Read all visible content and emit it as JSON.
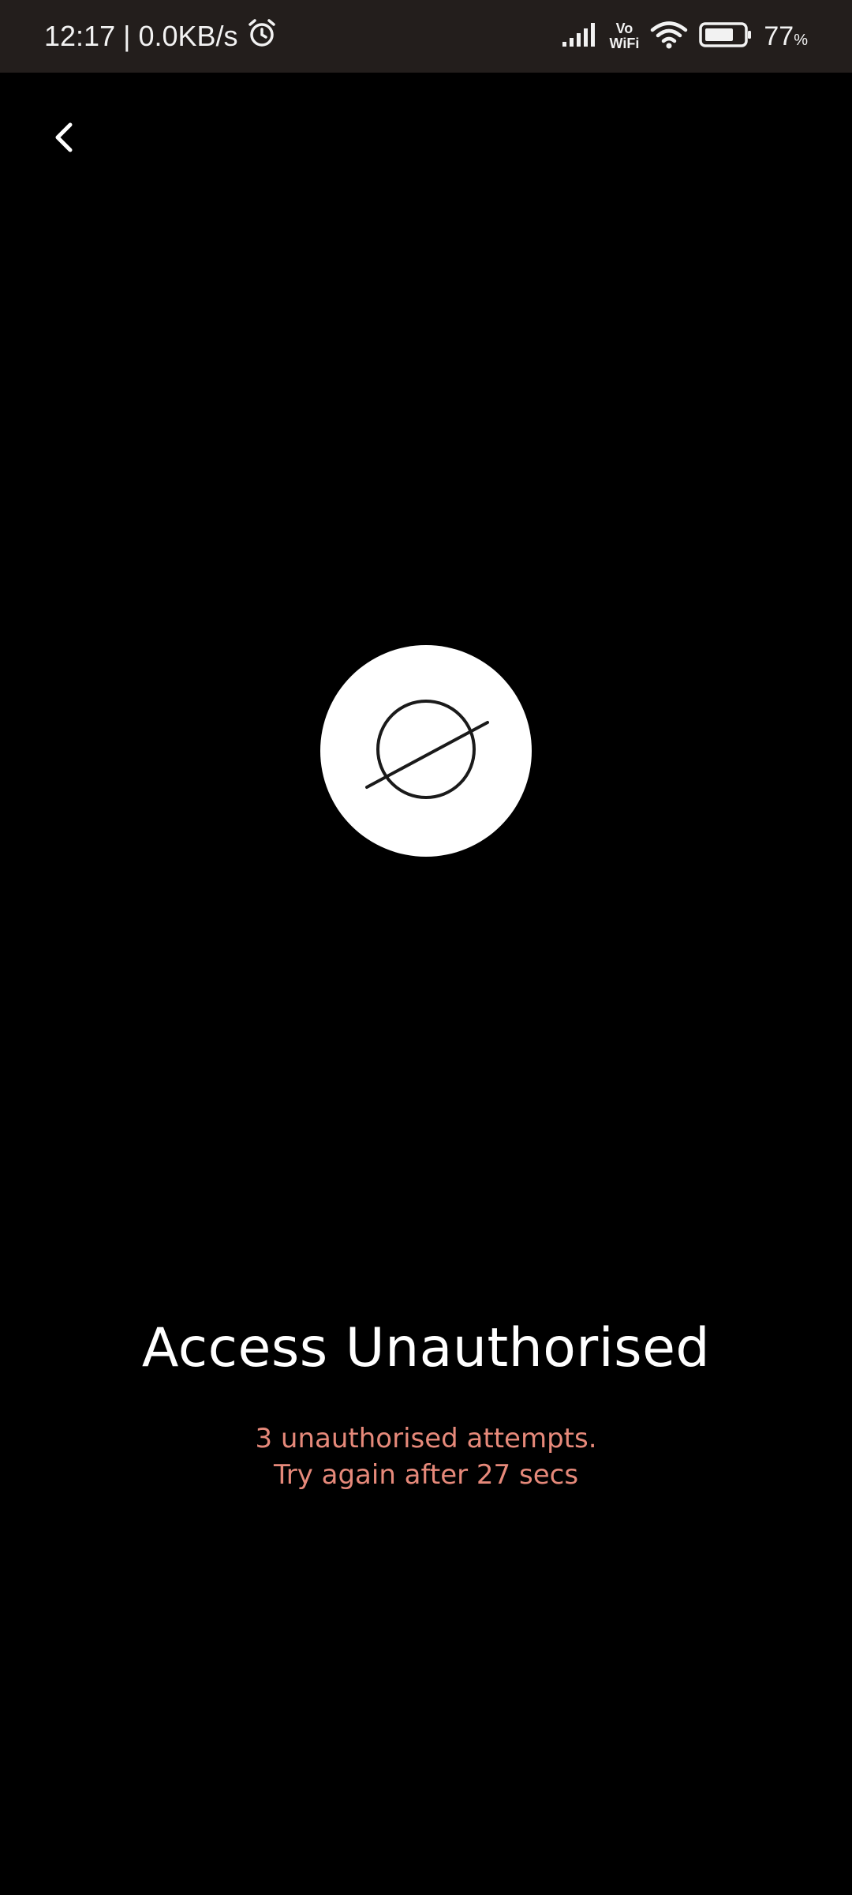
{
  "status_bar": {
    "time": "12:17",
    "separator": "|",
    "network_speed": "0.0KB/s",
    "alarm_icon": "alarm-clock-icon",
    "signal_icon": "cellular-signal-icon",
    "vowifi_top": "Vo",
    "vowifi_bottom": "WiFi",
    "wifi_icon": "wifi-icon",
    "battery_icon": "battery-icon",
    "battery_level": 77,
    "battery_percent": "77",
    "percent_sign": "%"
  },
  "nav": {
    "back_icon": "chevron-left-icon"
  },
  "badge": {
    "icon": "empty-set-icon"
  },
  "content": {
    "title": "Access Unauthorised",
    "message_line1": "3 unauthorised attempts.",
    "message_line2": "Try again after 27 secs"
  },
  "colors": {
    "background": "#000000",
    "status_bar": "#231e1c",
    "title": "#ffffff",
    "warning_text": "#e6897a"
  }
}
